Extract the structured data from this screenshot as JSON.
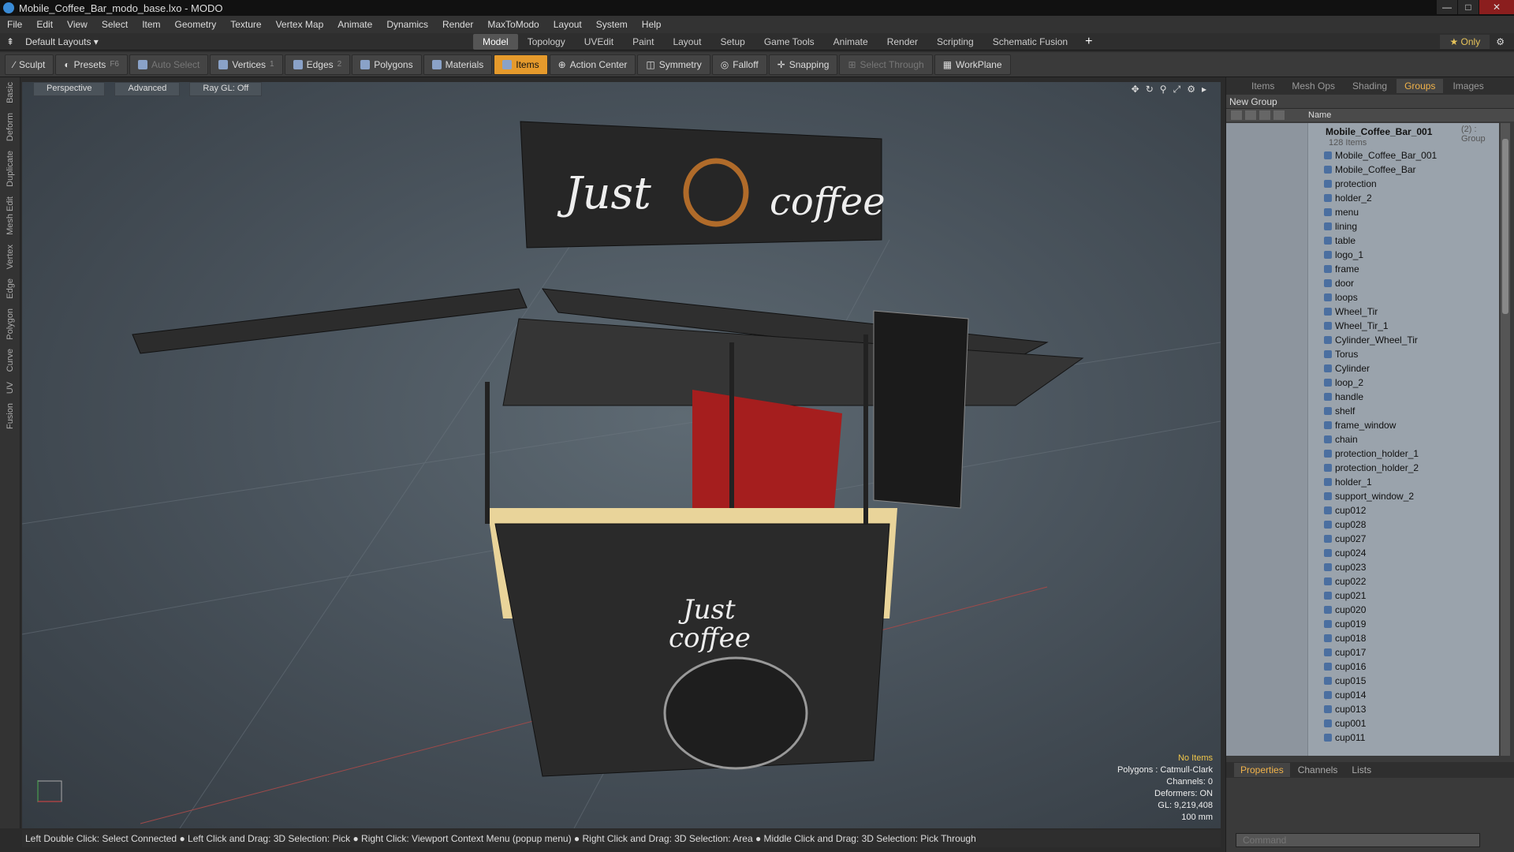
{
  "window": {
    "title": "Mobile_Coffee_Bar_modo_base.lxo - MODO"
  },
  "menu": [
    "File",
    "Edit",
    "View",
    "Select",
    "Item",
    "Geometry",
    "Texture",
    "Vertex Map",
    "Animate",
    "Dynamics",
    "Render",
    "MaxToModo",
    "Layout",
    "System",
    "Help"
  ],
  "layouts": {
    "label": "Default Layouts ▾",
    "tabs": [
      "Model",
      "Topology",
      "UVEdit",
      "Paint",
      "Layout",
      "Setup",
      "Game Tools",
      "Animate",
      "Render",
      "Scripting",
      "Schematic Fusion"
    ],
    "active": "Model",
    "only": "Only"
  },
  "toolbar": {
    "sculpt": "Sculpt",
    "presets": "Presets",
    "presets_key": "F6",
    "auto_select": "Auto Select",
    "vertices": "Vertices",
    "vertices_n": "1",
    "edges": "Edges",
    "edges_n": "2",
    "polygons": "Polygons",
    "materials": "Materials",
    "items": "Items",
    "action_center": "Action Center",
    "symmetry": "Symmetry",
    "falloff": "Falloff",
    "snapping": "Snapping",
    "select_through": "Select Through",
    "workplane": "WorkPlane"
  },
  "side_tabs": [
    "Basic",
    "Deform",
    "Duplicate",
    "Mesh Edit",
    "Vertex",
    "Edge",
    "Polygon",
    "Curve",
    "UV",
    "Fusion"
  ],
  "viewport": {
    "perspective": "Perspective",
    "advanced": "Advanced",
    "raygl": "Ray GL: Off",
    "hud": {
      "no_items": "No Items",
      "polygons": "Polygons : Catmull-Clark",
      "channels": "Channels: 0",
      "deformers": "Deformers: ON",
      "gl": "GL: 9,219,408",
      "scale": "100 mm"
    },
    "signs": {
      "just": "Just",
      "coffee": "coffee",
      "cart_just": "Just",
      "cart_coffee": "coffee"
    }
  },
  "statusbar": "Left Double Click: Select Connected ● Left Click and Drag: 3D Selection: Pick ● Right Click: Viewport Context Menu (popup menu) ● Right Click and Drag: 3D Selection: Area ● Middle Click and Drag: 3D Selection: Pick Through",
  "right_panel": {
    "tabs": [
      "Items",
      "Mesh Ops",
      "Shading",
      "Groups",
      "Images"
    ],
    "active": "Groups",
    "new_group": "New Group",
    "name_col": "Name",
    "group": {
      "name": "Mobile_Coffee_Bar_001",
      "count": "(2) : Group",
      "items": "128 Items"
    },
    "rows": [
      "Mobile_Coffee_Bar_001",
      "Mobile_Coffee_Bar",
      "protection",
      "holder_2",
      "menu",
      "lining",
      "table",
      "logo_1",
      "frame",
      "door",
      "loops",
      "Wheel_Tir",
      "Wheel_Tir_1",
      "Cylinder_Wheel_Tir",
      "Torus",
      "Cylinder",
      "loop_2",
      "handle",
      "shelf",
      "frame_window",
      "chain",
      "protection_holder_1",
      "protection_holder_2",
      "holder_1",
      "support_window_2",
      "cup012",
      "cup028",
      "cup027",
      "cup024",
      "cup023",
      "cup022",
      "cup021",
      "cup020",
      "cup019",
      "cup018",
      "cup017",
      "cup016",
      "cup015",
      "cup014",
      "cup013",
      "cup001",
      "cup011"
    ],
    "bottom_tabs": [
      "Properties",
      "Channels",
      "Lists"
    ],
    "command_placeholder": "Command"
  }
}
